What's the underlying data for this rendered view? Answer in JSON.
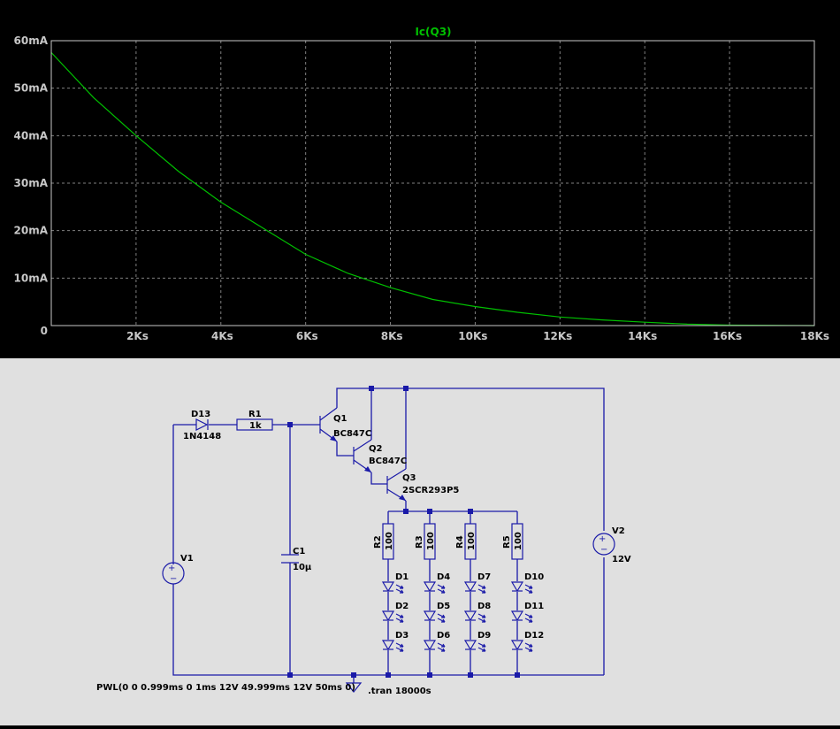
{
  "colors": {
    "plot_bg": "#000000",
    "grid": "#808080",
    "trace": "#00c000",
    "axis_text": "#c8c8c8",
    "schematic_bg": "#e0e0e0",
    "wire": "#1a1aa8"
  },
  "chart_data": {
    "type": "line",
    "title": "Ic(Q3)",
    "xlabel": "",
    "ylabel": "",
    "xlim": [
      0,
      18000
    ],
    "ylim": [
      0,
      60
    ],
    "grid": true,
    "x_ticks": [
      {
        "v": 2000,
        "label": "2Ks"
      },
      {
        "v": 4000,
        "label": "4Ks"
      },
      {
        "v": 6000,
        "label": "6Ks"
      },
      {
        "v": 8000,
        "label": "8Ks"
      },
      {
        "v": 10000,
        "label": "10Ks"
      },
      {
        "v": 12000,
        "label": "12Ks"
      },
      {
        "v": 14000,
        "label": "14Ks"
      },
      {
        "v": 16000,
        "label": "16Ks"
      },
      {
        "v": 18000,
        "label": "18Ks"
      }
    ],
    "y_ticks": [
      {
        "v": 0,
        "label": "0"
      },
      {
        "v": 10,
        "label": "10mA"
      },
      {
        "v": 20,
        "label": "20mA"
      },
      {
        "v": 30,
        "label": "30mA"
      },
      {
        "v": 40,
        "label": "40mA"
      },
      {
        "v": 50,
        "label": "50mA"
      },
      {
        "v": 60,
        "label": "60mA"
      }
    ],
    "series": [
      {
        "name": "Ic(Q3)",
        "x": [
          0,
          1000,
          2000,
          3000,
          4000,
          5000,
          6000,
          7000,
          8000,
          9000,
          10000,
          11000,
          12000,
          13000,
          14000,
          15000,
          16000,
          17000,
          18000
        ],
        "y": [
          57.5,
          48.0,
          40.0,
          32.5,
          26.0,
          20.5,
          15.0,
          11.0,
          8.0,
          5.5,
          4.0,
          2.8,
          1.8,
          1.2,
          0.7,
          0.3,
          0.1,
          0.05,
          0.0
        ]
      }
    ]
  },
  "schematic": {
    "components": {
      "D13": {
        "ref": "D13",
        "value": "1N4148"
      },
      "R1": {
        "ref": "R1",
        "value": "1k"
      },
      "Q1": {
        "ref": "Q1",
        "value": "BC847C"
      },
      "Q2": {
        "ref": "Q2",
        "value": "BC847C"
      },
      "Q3": {
        "ref": "Q3",
        "value": "2SCR293P5"
      },
      "C1": {
        "ref": "C1",
        "value": "10µ"
      },
      "V1": {
        "ref": "V1"
      },
      "V2": {
        "ref": "V2",
        "value": "12V"
      },
      "R2": {
        "ref": "R2",
        "value": "100"
      },
      "R3": {
        "ref": "R3",
        "value": "100"
      },
      "R4": {
        "ref": "R4",
        "value": "100"
      },
      "R5": {
        "ref": "R5",
        "value": "100"
      }
    },
    "leds": [
      [
        "D1",
        "D2",
        "D3"
      ],
      [
        "D4",
        "D5",
        "D6"
      ],
      [
        "D7",
        "D8",
        "D9"
      ],
      [
        "D10",
        "D11",
        "D12"
      ]
    ],
    "pwl_directive": "PWL(0 0 0.999ms 0 1ms 12V 49.999ms 12V 50ms 0)",
    "tran_directive": ".tran 18000s"
  }
}
